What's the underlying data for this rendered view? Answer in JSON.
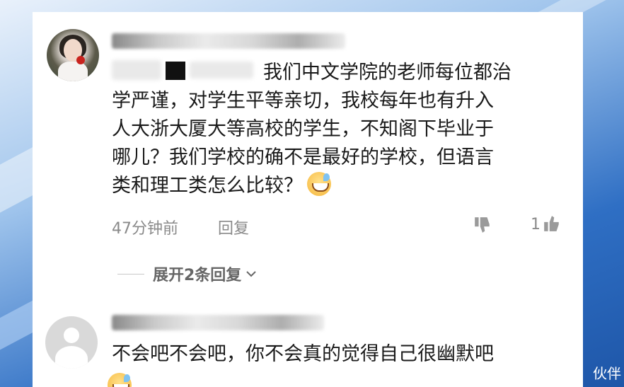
{
  "comments": [
    {
      "text_lines": [
        "我们中文学院的老师每位都治",
        "学严谨，对学生平等亲切，我校每年也有升入",
        "人大浙大厦大等高校的学生，不知阁下毕业于",
        "哪儿？我们学校的确不是最好的学校，但语言",
        "类和理工类怎么比较？"
      ],
      "emoji": "grinning-sweat-emoji",
      "time": "47分钟前",
      "reply_label": "回复",
      "like_count": "1",
      "expand_label": "展开2条回复"
    },
    {
      "text": "不会吧不会吧，你不会真的觉得自己很幽默吧"
    }
  ],
  "watermark": "伙伴",
  "icons": {
    "dislike": "thumbs-down-icon",
    "like": "thumbs-up-icon",
    "chevron": "chevron-down-icon"
  },
  "colors": {
    "text": "#1a1a1a",
    "meta": "#8a8a8a",
    "card": "#ffffff"
  }
}
